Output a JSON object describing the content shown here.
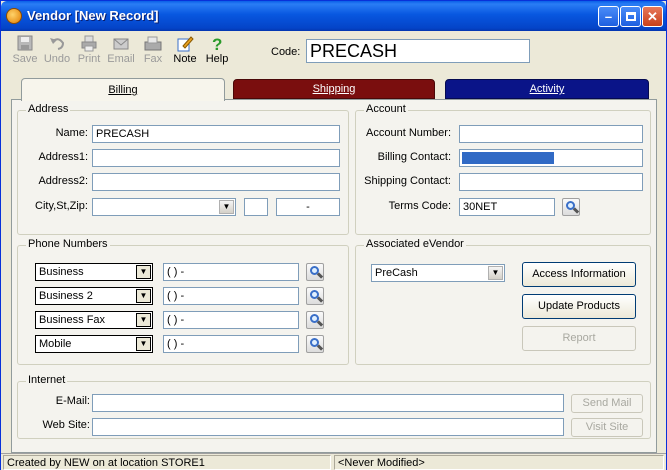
{
  "window": {
    "title": "Vendor [New Record]"
  },
  "toolbar": {
    "items": [
      {
        "label": "Save",
        "icon": "save-icon",
        "enabled": false
      },
      {
        "label": "Undo",
        "icon": "undo-icon",
        "enabled": false
      },
      {
        "label": "Print",
        "icon": "print-icon",
        "enabled": false
      },
      {
        "label": "Email",
        "icon": "email-icon",
        "enabled": false
      },
      {
        "label": "Fax",
        "icon": "fax-icon",
        "enabled": false
      },
      {
        "label": "Note",
        "icon": "note-icon",
        "enabled": true
      },
      {
        "label": "Help",
        "icon": "help-icon",
        "enabled": true
      }
    ]
  },
  "code": {
    "label": "Code:",
    "value": "PRECASH"
  },
  "tabs": [
    {
      "label": "Billing",
      "color": "#f7f5ec",
      "active": true
    },
    {
      "label": "Shipping",
      "color": "#7a0e0e",
      "active": false
    },
    {
      "label": "Activity",
      "color": "#0a1488",
      "active": false
    }
  ],
  "address": {
    "title": "Address",
    "name_label": "Name:",
    "name_value": "PRECASH",
    "address1_label": "Address1:",
    "address1_value": "",
    "address2_label": "Address2:",
    "address2_value": "",
    "city_label": "City,St,Zip:",
    "city_value": "",
    "state_value": "",
    "zip_value": " -"
  },
  "account": {
    "title": "Account",
    "number_label": "Account Number:",
    "number_value": "",
    "billing_contact_label": "Billing Contact:",
    "shipping_contact_label": "Shipping Contact:",
    "shipping_contact_value": "",
    "terms_label": "Terms Code:",
    "terms_value": "30NET"
  },
  "phones": {
    "title": "Phone Numbers",
    "rows": [
      {
        "type": "Business",
        "number": "(   )    -"
      },
      {
        "type": "Business 2",
        "number": "(   )    -"
      },
      {
        "type": "Business Fax",
        "number": "(   )    -"
      },
      {
        "type": "Mobile",
        "number": "(   )    -"
      }
    ]
  },
  "evendor": {
    "title": "Associated eVendor",
    "selected": "PreCash",
    "access_label": "Access Information",
    "update_label": "Update Products",
    "report_label": "Report"
  },
  "internet": {
    "title": "Internet",
    "email_label": "E-Mail:",
    "email_value": "",
    "website_label": "Web Site:",
    "website_value": "",
    "send_mail_label": "Send Mail",
    "visit_site_label": "Visit Site"
  },
  "status": {
    "created": "Created by NEW on  at location STORE1",
    "modified": "<Never Modified>"
  }
}
